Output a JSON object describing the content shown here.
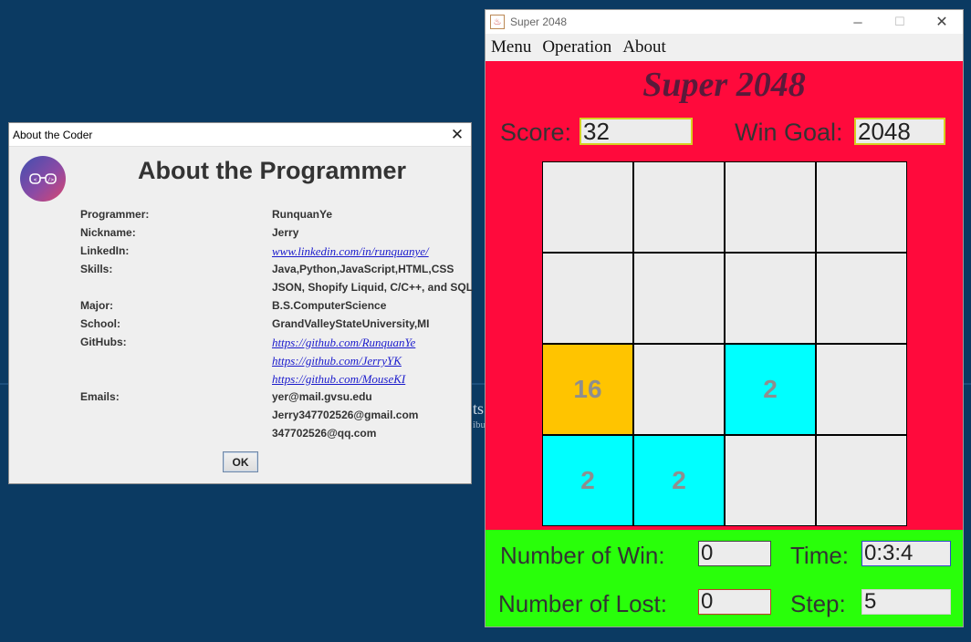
{
  "about_dialog": {
    "title": "About the Coder",
    "heading": "About the Programmer",
    "ok_label": "OK",
    "rows": [
      {
        "label": "Programmer:",
        "value": "RunquanYe",
        "type": "text"
      },
      {
        "label": "Nickname:",
        "value": "Jerry",
        "type": "text"
      },
      {
        "label": "LinkedIn:",
        "value": "www.linkedin.com/in/runquanye/",
        "type": "link"
      },
      {
        "label": "Skills:",
        "value": "Java,Python,JavaScript,HTML,CSS",
        "type": "text"
      },
      {
        "label": "",
        "value": "JSON, Shopify Liquid, C/C++, and SQL",
        "type": "text"
      },
      {
        "label": "Major:",
        "value": "B.S.ComputerScience",
        "type": "text"
      },
      {
        "label": "School:",
        "value": "GrandValleyStateUniversity,MI",
        "type": "text"
      },
      {
        "label": "GitHubs:",
        "value": "https://github.com/RunquanYe",
        "type": "link"
      },
      {
        "label": "",
        "value": "https://github.com/JerryYK",
        "type": "link"
      },
      {
        "label": "",
        "value": "https://github.com/MouseKI",
        "type": "link"
      },
      {
        "label": "Emails:",
        "value": "yer@mail.gvsu.edu",
        "type": "text"
      },
      {
        "label": "",
        "value": "Jerry347702526@gmail.com",
        "type": "text"
      },
      {
        "label": "",
        "value": "347702526@qq.com",
        "type": "text"
      }
    ]
  },
  "game_window": {
    "title": "Super 2048",
    "menu": [
      "Menu",
      "Operation",
      "About"
    ],
    "heading": "Super 2048",
    "score_label": "Score:",
    "score_value": "32",
    "goal_label": "Win Goal:",
    "goal_value": "2048",
    "board": [
      [
        "",
        "",
        "",
        ""
      ],
      [
        "",
        "",
        "",
        ""
      ],
      [
        "16",
        "",
        "2",
        ""
      ],
      [
        "2",
        "2",
        "",
        ""
      ]
    ],
    "tile_colors": {
      "": "#ececec",
      "2": "#00ffff",
      "16": "#ffc400"
    },
    "wins_label": "Number of Win:",
    "wins_value": "0",
    "time_label": "Time:",
    "time_value": "0:3:4",
    "lost_label": "Number of Lost:",
    "lost_value": "0",
    "step_label": "Step:",
    "step_value": "5"
  },
  "desktop": {
    "bg_text": "ts",
    "bg_text_small": "ibu"
  }
}
